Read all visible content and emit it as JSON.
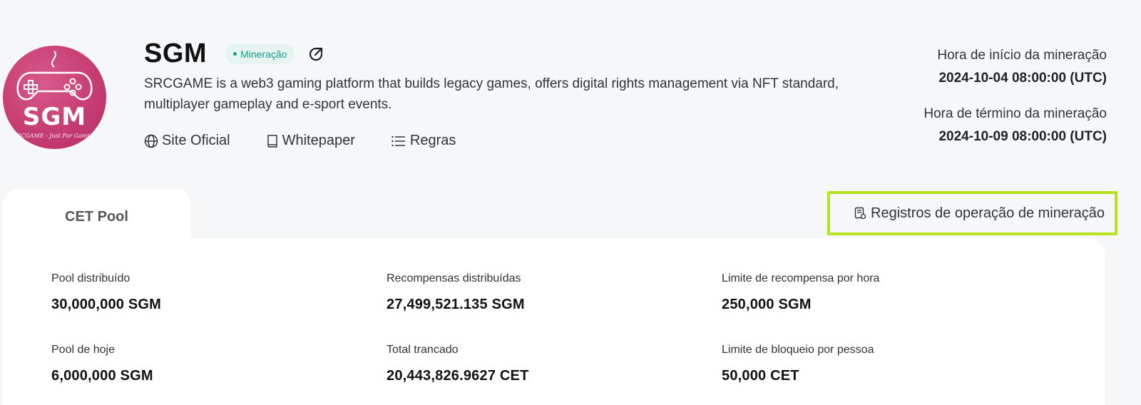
{
  "token": {
    "symbol": "SGM",
    "status": "Mineração",
    "logo_text": "SGM",
    "logo_subtext": "SRCGAME - Just For Gaming",
    "description": "SRCGAME is a web3 gaming platform that builds legacy games, offers digital rights management via NFT standard, multiplayer gameplay and e-sport events.",
    "links": [
      {
        "label": "Site Oficial",
        "icon": "globe-icon"
      },
      {
        "label": "Whitepaper",
        "icon": "book-icon"
      },
      {
        "label": "Regras",
        "icon": "list-icon"
      }
    ]
  },
  "mining_times": {
    "start_label": "Hora de início da mineração",
    "start_value": "2024-10-04 08:00:00 (UTC)",
    "end_label": "Hora de término da mineração",
    "end_value": "2024-10-09 08:00:00 (UTC)"
  },
  "tabs": [
    {
      "label": "CET Pool",
      "active": true
    }
  ],
  "records_link": {
    "label": "Registros de operação de mineração",
    "icon": "document-icon"
  },
  "stats": [
    {
      "label": "Pool distribuído",
      "value": "30,000,000 SGM"
    },
    {
      "label": "Recompensas distribuídas",
      "value": "27,499,521.135 SGM"
    },
    {
      "label": "Limite de recompensa por hora",
      "value": "250,000 SGM"
    },
    {
      "label": "Pool de hoje",
      "value": "6,000,000 SGM"
    },
    {
      "label": "Total trancado",
      "value": "20,443,826.9627 CET"
    },
    {
      "label": "Limite de bloqueio por pessoa",
      "value": "50,000 CET"
    }
  ],
  "colors": {
    "accent_highlight": "#b5e31f",
    "status_green": "#16a08a",
    "logo_pink": "#c63d72"
  }
}
